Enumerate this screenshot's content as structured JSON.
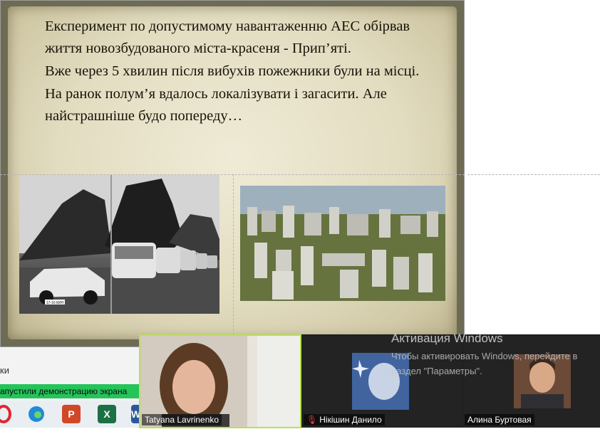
{
  "slide": {
    "paragraphs": [
      " Експеримент по допустимому навантаженню АЕС обірвав життя новозбудованого міста-красеня - Прип’яті.",
      " Вже через 5 хвилин після вибухів пожежники були на місці.",
      " На ранок полум’я вдалось локалізувати і загасити. Але найстрашніше будо попереду…"
    ],
    "photo_left_plate": "17-16 КИН"
  },
  "app": {
    "left_label": "ки",
    "share_status": "апустили демонстрацию экрана"
  },
  "taskbar": {
    "icons": [
      "opera-icon",
      "edge-icon",
      "powerpoint-icon",
      "excel-icon",
      "word-icon"
    ]
  },
  "participants": [
    {
      "name": "Tatyana Lavrinenko",
      "muted": false,
      "active": true
    },
    {
      "name": "Нікішин Данило",
      "muted": true,
      "active": false
    },
    {
      "name": "Алина Буртовая",
      "muted": false,
      "active": false
    }
  ],
  "watermark": {
    "title": "Активация Windows",
    "subtitle": "Чтобы активировать Windows, перейдите в раздел \"Параметры\"."
  },
  "colors": {
    "share_bar": "#24c45a",
    "active_speaker_border": "#b5e34a",
    "muted_icon": "#e04848"
  }
}
